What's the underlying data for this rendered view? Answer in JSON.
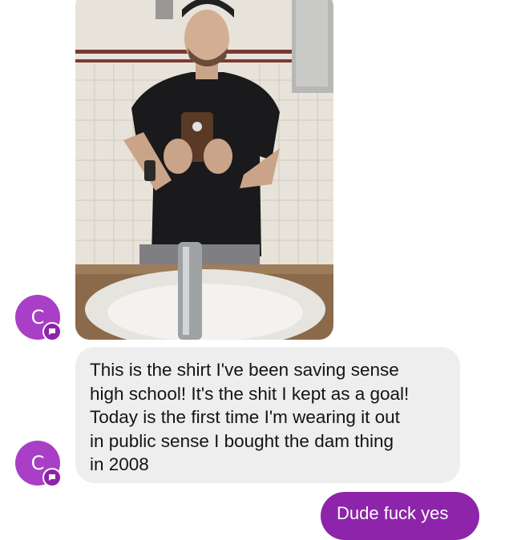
{
  "thread": {
    "contact_initial": "C",
    "colors": {
      "avatar": "#a93fc6",
      "incoming_bubble": "#eeeeee",
      "outgoing_bubble": "#8e24aa"
    },
    "messages": [
      {
        "type": "image",
        "direction": "incoming"
      },
      {
        "type": "text",
        "direction": "incoming",
        "lines": [
          "This is the shirt I've been saving sense",
          "high school! It's the shit I kept as a goal!",
          "Today is the first time I'm wearing it out",
          "in public sense I bought the dam thing",
          "in 2008"
        ]
      },
      {
        "type": "text",
        "direction": "outgoing",
        "text": "Dude fuck yes"
      }
    ]
  },
  "icons": {
    "avatar_badge": "chat-bubble-icon"
  }
}
